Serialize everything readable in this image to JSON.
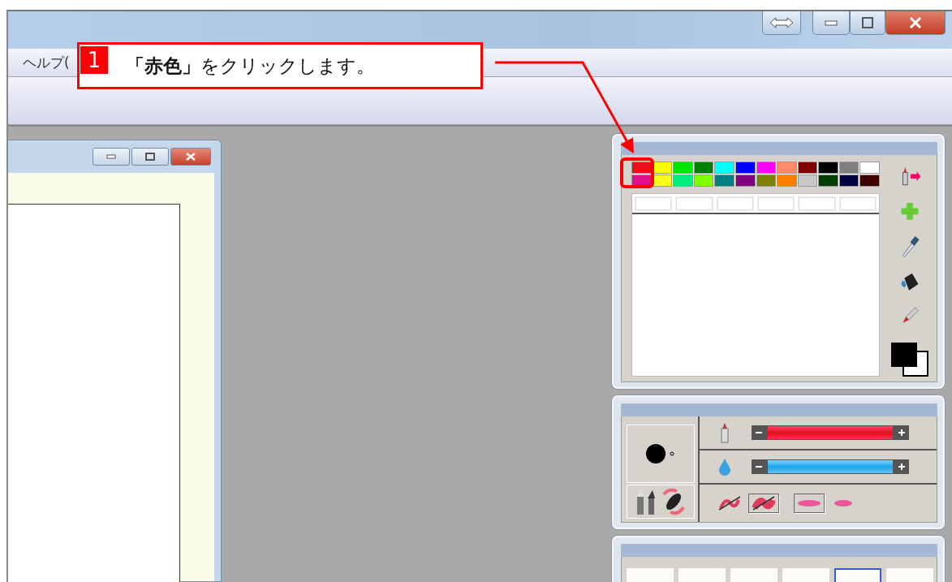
{
  "menu": [
    {
      "label": "ヘルプ("
    }
  ],
  "callout": {
    "number": "1",
    "text": "**「赤色」**をクリックします。"
  },
  "palette": [
    [
      {
        "color": "#e8101c"
      },
      {
        "color": "#ffff00"
      },
      {
        "color": "#00e600"
      },
      {
        "color": "#008000"
      },
      {
        "color": "#00ffff"
      },
      {
        "color": "#0000ff"
      },
      {
        "color": "#ff00ff"
      },
      {
        "color": "#ff8c69"
      },
      {
        "color": "#800000"
      },
      {
        "color": "#000000"
      },
      {
        "color": "#808080"
      },
      {
        "color": "#ffffff"
      }
    ],
    [
      {
        "color": "#e0108a"
      },
      {
        "color": "#ffff20"
      },
      {
        "color": "#00f080"
      },
      {
        "color": "#80ff00"
      },
      {
        "color": "#008080"
      },
      {
        "color": "#800080"
      },
      {
        "color": "#808000"
      },
      {
        "color": "#ff8000"
      },
      {
        "color": "#c8c8c8"
      },
      {
        "color": "#004000"
      },
      {
        "color": "#000040"
      },
      {
        "color": "#400000"
      }
    ]
  ],
  "sliders": [
    {
      "kind": "density",
      "level": 1
    },
    {
      "kind": "water",
      "level": 1
    }
  ],
  "stroke_styles": [
    {
      "selected": false
    },
    {
      "selected": true
    }
  ],
  "tip_shapes": [
    {
      "selected": true
    },
    {
      "selected": false
    }
  ],
  "brush_sizes": [
    {
      "selected": false
    },
    {
      "selected": false
    },
    {
      "selected": false
    },
    {
      "selected": false
    },
    {
      "selected": true
    },
    {
      "selected": false
    }
  ]
}
